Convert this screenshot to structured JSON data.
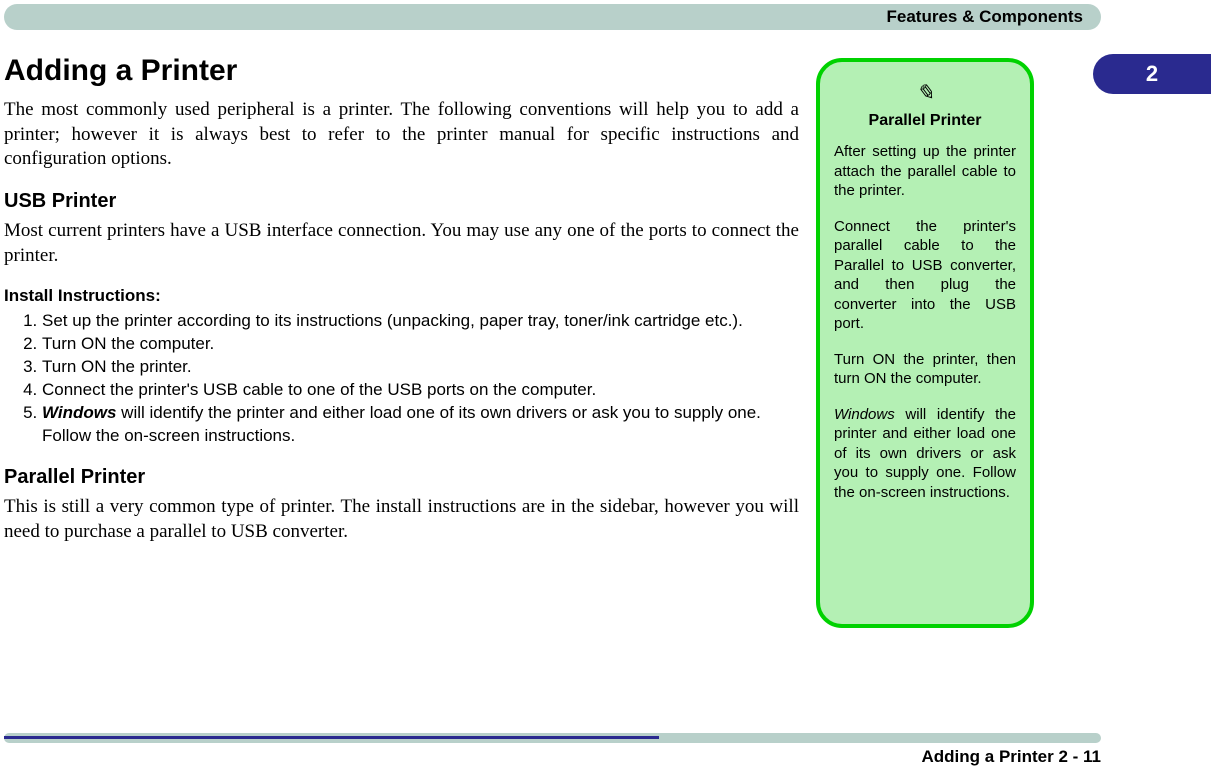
{
  "header": {
    "title": "Features & Components"
  },
  "chapter": {
    "number": "2"
  },
  "main": {
    "title": "Adding a Printer",
    "intro": "The most commonly used peripheral is a printer. The following conventions will help you to add a printer; however it is always best to refer to the printer manual for specific instructions and configuration options.",
    "usb": {
      "heading": "USB Printer",
      "text": "Most current printers have a USB interface connection. You may use any one of the ports to connect the printer.",
      "install_heading": "Install Instructions:",
      "steps": [
        "Set up the printer according to its instructions (unpacking, paper tray, toner/ink cartridge etc.).",
        "Turn ON the computer.",
        "Turn ON the printer.",
        "Connect the printer's USB cable to one of the USB ports on the computer.",
        ""
      ],
      "step5_pre": "Windows",
      "step5_rest": " will identify the printer and either load one of its own drivers or ask you to supply one. Follow the on-screen instructions."
    },
    "parallel": {
      "heading": "Parallel Printer",
      "text": "This is still a very common type of printer. The install instructions are in the sidebar, however you will need to purchase a parallel to USB converter."
    }
  },
  "note": {
    "icon": "✎",
    "title": "Parallel Printer",
    "p1": "After setting up the printer attach the parallel cable to the printer.",
    "p2": "Connect the printer's parallel cable to the Parallel to USB converter, and then plug the converter into the USB port.",
    "p3": "Turn ON the printer, then turn ON the computer.",
    "p4_pre": "Windows",
    "p4_rest": " will identify the printer and either load one of its own drivers or ask you to supply one. Follow the on-screen instructions."
  },
  "footer": {
    "text": "Adding a Printer  2  -  11"
  }
}
